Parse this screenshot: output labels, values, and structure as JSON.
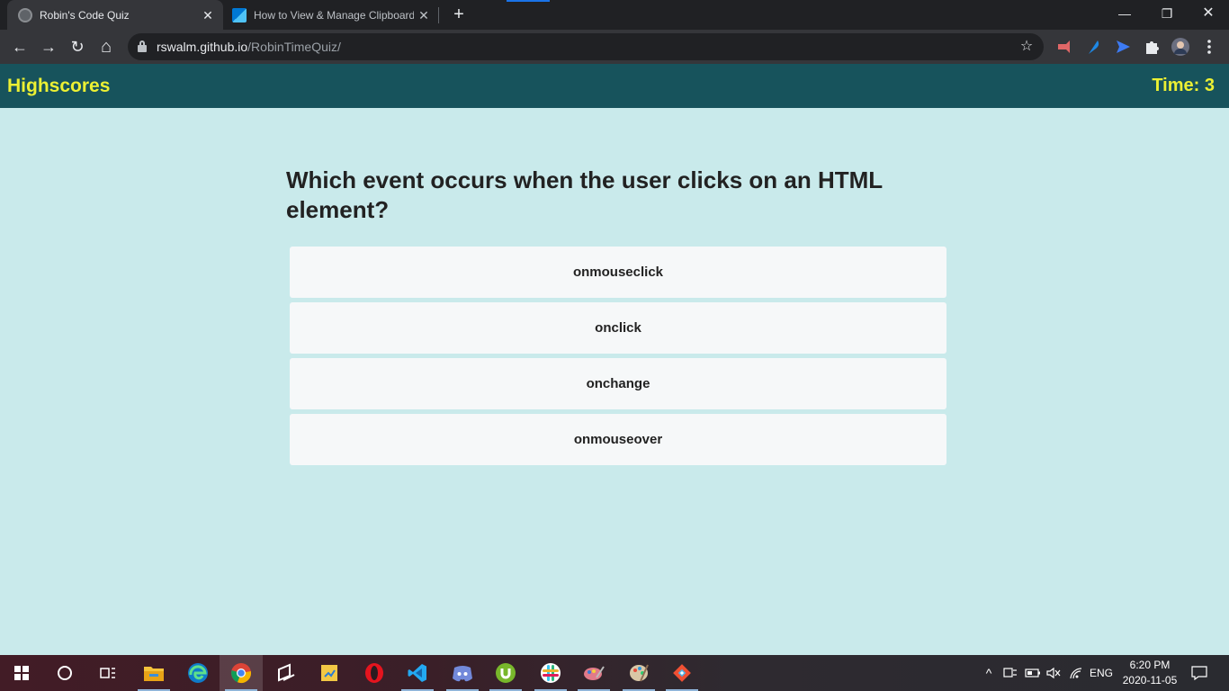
{
  "browser": {
    "tabs": [
      {
        "title": "Robin's Code Quiz",
        "close": "✕"
      },
      {
        "title": "How to View & Manage Clipboard",
        "close": "✕"
      }
    ],
    "new_tab": "+",
    "window_controls": {
      "minimize": "—",
      "maximize": "❐",
      "close": "✕"
    },
    "nav": {
      "back": "←",
      "forward": "→",
      "reload": "↻",
      "home": "⌂"
    },
    "url": {
      "host": "rswalm.github.io",
      "path": "/RobinTimeQuiz/"
    },
    "star": "☆"
  },
  "page": {
    "highscores_label": "Highscores",
    "timer_text": "Time: 3",
    "question": "Which event occurs when the user clicks on an HTML element?",
    "answers": [
      "onmouseclick",
      "onclick",
      "onchange",
      "onmouseover"
    ]
  },
  "taskbar": {
    "apps": [
      "start-icon",
      "search-icon",
      "task-view-icon",
      "file-explorer-icon",
      "edge-icon",
      "chrome-icon",
      "snip-icon",
      "sticky-icon",
      "opera-icon",
      "vscode-icon",
      "discord-icon",
      "utorrent-icon",
      "slack-icon",
      "paint-icon",
      "palette-icon",
      "git-icon"
    ],
    "tray": {
      "chevron": "^",
      "language": "ENG"
    },
    "time": "6:20 PM",
    "date": "2020-11-05"
  }
}
